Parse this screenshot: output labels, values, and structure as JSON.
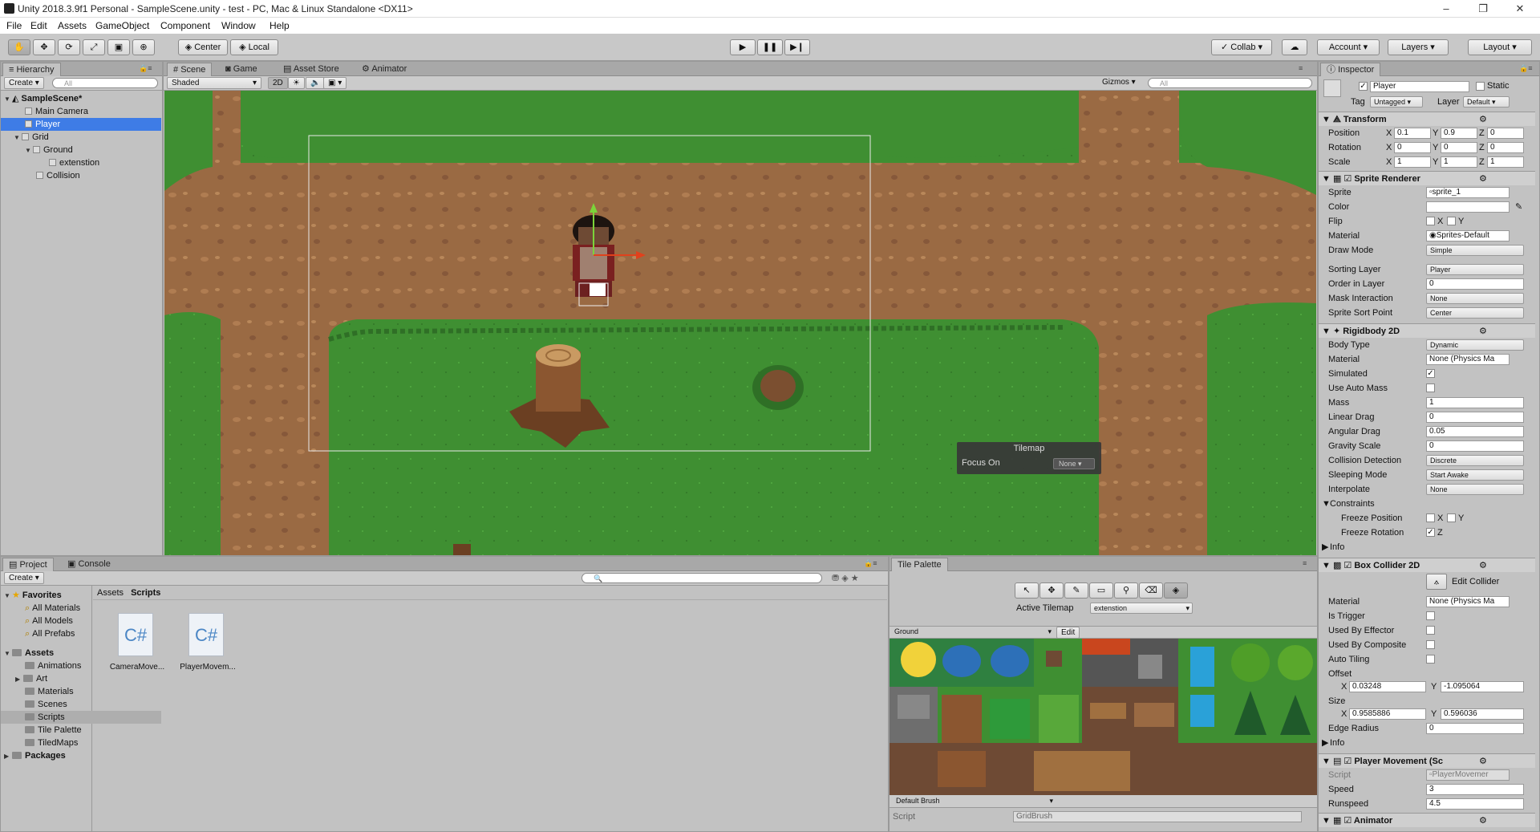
{
  "window": {
    "title": "Unity 2018.3.9f1 Personal - SampleScene.unity - test - PC, Mac & Linux Standalone <DX11>"
  },
  "menu": [
    "File",
    "Edit",
    "Assets",
    "GameObject",
    "Component",
    "Window",
    "Help"
  ],
  "toolbar": {
    "pivot": "Center",
    "space": "Local",
    "collab": "Collab",
    "account": "Account",
    "layers": "Layers",
    "layout": "Layout"
  },
  "hierarchy": {
    "tab": "Hierarchy",
    "create": "Create",
    "search_placeholder": "All",
    "scene": "SampleScene*",
    "items": [
      {
        "label": "Main Camera"
      },
      {
        "label": "Player"
      },
      {
        "label": "Grid"
      },
      {
        "label": "Ground"
      },
      {
        "label": "extenstion"
      },
      {
        "label": "Collision"
      }
    ]
  },
  "scene_view": {
    "tabs": [
      "Scene",
      "Game",
      "Asset Store",
      "Animator"
    ],
    "shading": "Shaded",
    "mode2d": "2D",
    "gizmos": "Gizmos",
    "search_placeholder": "All",
    "overlay": {
      "title": "Tilemap",
      "focus_label": "Focus On",
      "focus_value": "None"
    }
  },
  "inspector": {
    "tab": "Inspector",
    "object_name": "Player",
    "static_label": "Static",
    "tag_label": "Tag",
    "tag_value": "Untagged",
    "layer_label": "Layer",
    "layer_value": "Default",
    "transform": {
      "title": "Transform",
      "rows": [
        {
          "label": "Position",
          "x": "0.1",
          "y": "0.9",
          "z": "0"
        },
        {
          "label": "Rotation",
          "x": "0",
          "y": "0",
          "z": "0"
        },
        {
          "label": "Scale",
          "x": "1",
          "y": "1",
          "z": "1"
        }
      ]
    },
    "sprite_renderer": {
      "title": "Sprite Renderer",
      "sprite_label": "Sprite",
      "sprite_value": "sprite_1",
      "color_label": "Color",
      "flip_label": "Flip",
      "material_label": "Material",
      "material_value": "Sprites-Default",
      "draw_mode_label": "Draw Mode",
      "draw_mode_value": "Simple",
      "sorting_layer_label": "Sorting Layer",
      "sorting_layer_value": "Player",
      "order_label": "Order in Layer",
      "order_value": "0",
      "mask_label": "Mask Interaction",
      "mask_value": "None",
      "sort_point_label": "Sprite Sort Point",
      "sort_point_value": "Center"
    },
    "rigidbody": {
      "title": "Rigidbody 2D",
      "body_type_label": "Body Type",
      "body_type_value": "Dynamic",
      "material_label": "Material",
      "material_value": "None (Physics Ma",
      "simulated_label": "Simulated",
      "auto_mass_label": "Use Auto Mass",
      "mass_label": "Mass",
      "mass_value": "1",
      "linear_drag_label": "Linear Drag",
      "linear_drag_value": "0",
      "angular_drag_label": "Angular Drag",
      "angular_drag_value": "0.05",
      "gravity_label": "Gravity Scale",
      "gravity_value": "0",
      "collision_label": "Collision Detection",
      "collision_value": "Discrete",
      "sleeping_label": "Sleeping Mode",
      "sleeping_value": "Start Awake",
      "interpolate_label": "Interpolate",
      "interpolate_value": "None",
      "constraints_label": "Constraints",
      "freeze_pos_label": "Freeze Position",
      "freeze_rot_label": "Freeze Rotation",
      "info_label": "Info"
    },
    "box_collider": {
      "title": "Box Collider 2D",
      "edit_label": "Edit Collider",
      "material_label": "Material",
      "material_value": "None (Physics Ma",
      "trigger_label": "Is Trigger",
      "effector_label": "Used By Effector",
      "composite_label": "Used By Composite",
      "tiling_label": "Auto Tiling",
      "offset_label": "Offset",
      "offset_x": "0.03248",
      "offset_y": "-1.095064",
      "size_label": "Size",
      "size_x": "0.9585886",
      "size_y": "0.596036",
      "edge_label": "Edge Radius",
      "edge_value": "0",
      "info_label": "Info"
    },
    "player_movement": {
      "title": "Player Movement (Sc",
      "script_label": "Script",
      "script_value": "PlayerMovemer",
      "speed_label": "Speed",
      "speed_value": "3",
      "runspeed_label": "Runspeed",
      "runspeed_value": "4.5"
    },
    "animator": {
      "title": "Animator"
    }
  },
  "project": {
    "tabs": [
      "Project",
      "Console"
    ],
    "create": "Create",
    "favorites_label": "Favorites",
    "favorites": [
      "All Materials",
      "All Models",
      "All Prefabs"
    ],
    "assets_label": "Assets",
    "assets": [
      "Animations",
      "Art",
      "Materials",
      "Scenes",
      "Scripts",
      "Tile Palette",
      "TiledMaps"
    ],
    "packages_label": "Packages",
    "breadcrumb": [
      "Assets",
      "Scripts"
    ],
    "files": [
      {
        "name": "CameraMove...",
        "glyph": "C#"
      },
      {
        "name": "PlayerMovem...",
        "glyph": "C#"
      }
    ]
  },
  "tile_palette": {
    "tab": "Tile Palette",
    "active_label": "Active Tilemap",
    "active_value": "extenstion",
    "palette": "Ground",
    "edit_label": "Edit",
    "brush": "Default Brush",
    "script_label": "Script",
    "script_value": "GridBrush"
  },
  "colors": {
    "selection": "#3e7ce6",
    "grass": "#3f8f32",
    "dirt": "#9a6a43"
  }
}
